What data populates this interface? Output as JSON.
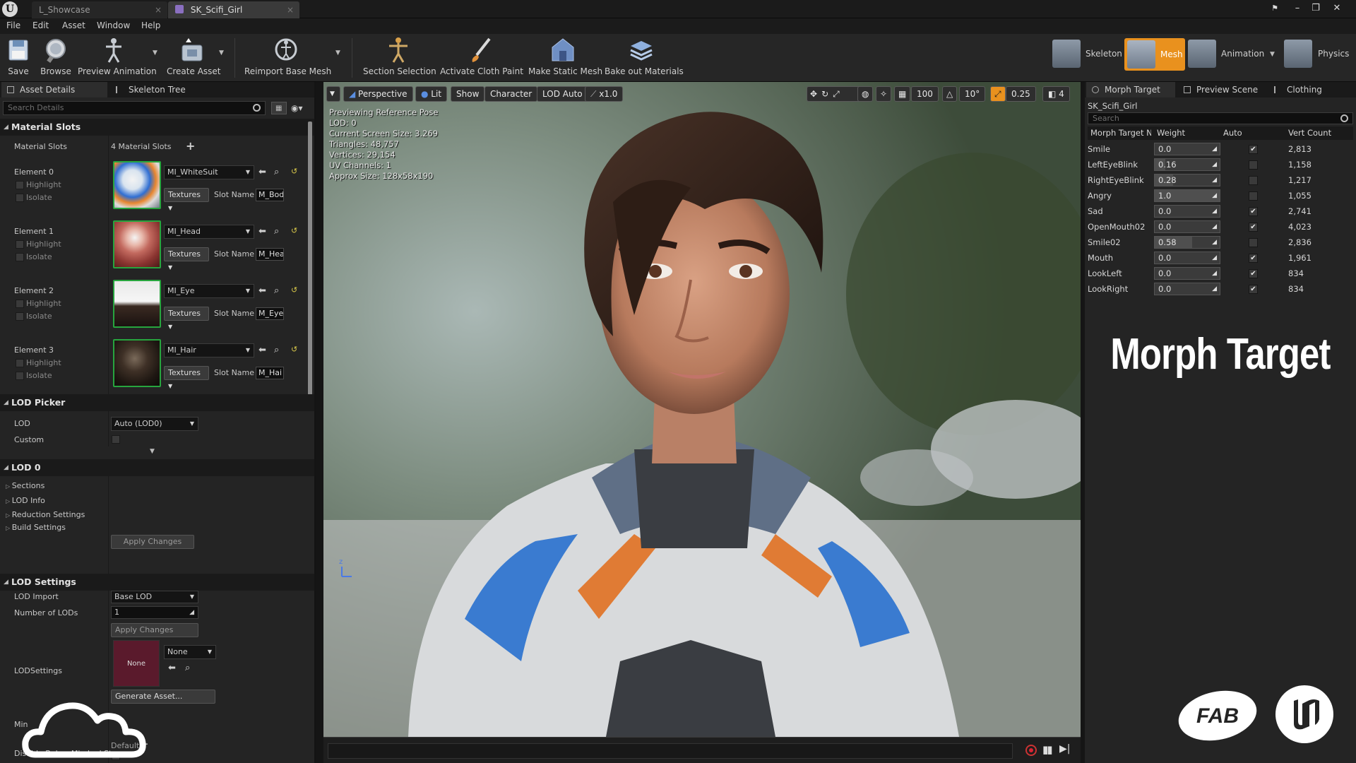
{
  "titlebar": {
    "tabs": [
      {
        "label": "L_Showcase"
      },
      {
        "label": "SK_Scifi_Girl"
      }
    ]
  },
  "menubar": {
    "items": [
      "File",
      "Edit",
      "Asset",
      "Window",
      "Help"
    ]
  },
  "toolbar": {
    "buttons": [
      {
        "label": "Save",
        "icon": "save-icon"
      },
      {
        "label": "Browse",
        "icon": "browse-icon"
      },
      {
        "label": "Preview Animation",
        "icon": "preview-animation-icon"
      },
      {
        "label": "Create Asset",
        "icon": "create-asset-icon"
      },
      {
        "label": "Reimport Base Mesh",
        "icon": "reimport-icon"
      },
      {
        "label": "Section Selection",
        "icon": "section-selection-icon"
      },
      {
        "label": "Activate Cloth Paint",
        "icon": "cloth-paint-icon"
      },
      {
        "label": "Make Static Mesh",
        "icon": "static-mesh-icon"
      },
      {
        "label": "Bake out Materials",
        "icon": "bake-materials-icon"
      }
    ],
    "modes": [
      {
        "label": "Skeleton",
        "active": false
      },
      {
        "label": "Mesh",
        "active": true
      },
      {
        "label": "Animation",
        "active": false
      },
      {
        "label": "Physics",
        "active": false
      }
    ],
    "accent": "#e9911e"
  },
  "left_panel": {
    "tabs": [
      "Asset Details",
      "Skeleton Tree"
    ],
    "search_placeholder": "Search Details",
    "material_slots": {
      "header": "Material Slots",
      "label": "Material Slots",
      "count_text": "4 Material Slots",
      "highlight_label": "Highlight",
      "isolate_label": "Isolate",
      "textures_label": "Textures",
      "slot_name_label": "Slot Name",
      "elements": [
        {
          "label": "Element 0",
          "material": "MI_WhiteSuit",
          "slot_name": "M_Bod"
        },
        {
          "label": "Element 1",
          "material": "MI_Head",
          "slot_name": "M_Hea"
        },
        {
          "label": "Element 2",
          "material": "MI_Eye",
          "slot_name": "M_Eye"
        },
        {
          "label": "Element 3",
          "material": "MI_Hair",
          "slot_name": "M_Hai"
        }
      ]
    },
    "lod_picker": {
      "header": "LOD Picker",
      "lod_label": "LOD",
      "lod_value": "Auto (LOD0)",
      "custom_label": "Custom"
    },
    "lod0": {
      "header": "LOD 0",
      "items": [
        "Sections",
        "LOD Info",
        "Reduction Settings",
        "Build Settings"
      ],
      "apply_label": "Apply Changes"
    },
    "lod_settings": {
      "header": "LOD Settings",
      "import_label": "LOD Import",
      "import_value": "Base LOD",
      "num_lods_label": "Number of LODs",
      "num_lods_value": "1",
      "apply_label": "Apply Changes",
      "lodsettings_label": "LODSettings",
      "asset_thumb_label": "None",
      "asset_value": "None",
      "generate_label": "Generate Asset...",
      "min_lod_label": "Min",
      "min_lod_default": "Default",
      "disable_label": "Disable Below Min Lod Str"
    }
  },
  "viewport": {
    "toolbar": {
      "perspective": "Perspective",
      "lit": "Lit",
      "show": "Show",
      "character": "Character",
      "lod": "LOD Auto",
      "speed": "x1.0",
      "grid": "100",
      "angle": "10°",
      "scale": "0.25",
      "camera_speed": "4"
    },
    "stats": [
      "Previewing Reference Pose",
      "LOD: 0",
      "Current Screen Size: 3.269",
      "Triangles: 48,757",
      "Vertices: 29,154",
      "UV Channels: 1",
      "Approx Size: 128x58x190"
    ]
  },
  "right_panel": {
    "tabs": [
      "Morph Target",
      "Preview Scene",
      "Clothing"
    ],
    "asset_name": "SK_Scifi_Girl",
    "search_placeholder": "Search",
    "columns": [
      "Morph Target N",
      "Weight",
      "Auto",
      "Vert Count"
    ],
    "rows": [
      {
        "name": "Smile",
        "weight": "0.0",
        "fill": 0.0,
        "auto": true,
        "verts": "2,813"
      },
      {
        "name": "LeftEyeBlink",
        "weight": "0.16",
        "fill": 0.16,
        "auto": false,
        "verts": "1,158"
      },
      {
        "name": "RightEyeBlink",
        "weight": "0.28",
        "fill": 0.28,
        "auto": false,
        "verts": "1,217"
      },
      {
        "name": "Angry",
        "weight": "1.0",
        "fill": 1.0,
        "auto": false,
        "verts": "1,055"
      },
      {
        "name": "Sad",
        "weight": "0.0",
        "fill": 0.0,
        "auto": true,
        "verts": "2,741"
      },
      {
        "name": "OpenMouth02",
        "weight": "0.0",
        "fill": 0.0,
        "auto": true,
        "verts": "4,023"
      },
      {
        "name": "Smile02",
        "weight": "0.58",
        "fill": 0.58,
        "auto": false,
        "verts": "2,836"
      },
      {
        "name": "Mouth",
        "weight": "0.0",
        "fill": 0.0,
        "auto": true,
        "verts": "1,961"
      },
      {
        "name": "LookLeft",
        "weight": "0.0",
        "fill": 0.0,
        "auto": true,
        "verts": "834"
      },
      {
        "name": "LookRight",
        "weight": "0.0",
        "fill": 0.0,
        "auto": true,
        "verts": "834"
      }
    ],
    "overlay_title": "Morph Target",
    "fab_logo_text": "FAB"
  }
}
